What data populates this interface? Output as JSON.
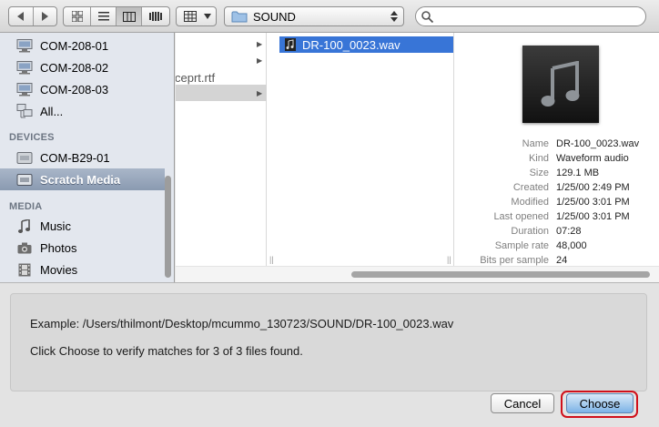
{
  "toolbar": {
    "path_popup": "SOUND",
    "search_placeholder": ""
  },
  "sidebar": {
    "shared_items": [
      "COM-208-01",
      "COM-208-02",
      "COM-208-03",
      "All..."
    ],
    "devices_header": "DEVICES",
    "devices": [
      {
        "label": "COM-B29-01",
        "icon": "drive-icon",
        "selected": false
      },
      {
        "label": "Scratch Media",
        "icon": "drive-icon",
        "selected": true
      }
    ],
    "media_header": "MEDIA",
    "media": [
      {
        "label": "Music",
        "icon": "music-note-icon"
      },
      {
        "label": "Photos",
        "icon": "camera-icon"
      },
      {
        "label": "Movies",
        "icon": "film-icon"
      }
    ]
  },
  "columns": {
    "col1_partial_file": "ceprt.rtf",
    "selected_file": "DR-100_0023.wav"
  },
  "preview": {
    "rows": [
      {
        "key": "Name",
        "value": "DR-100_0023.wav"
      },
      {
        "key": "Kind",
        "value": "Waveform audio"
      },
      {
        "key": "Size",
        "value": "129.1 MB"
      },
      {
        "key": "Created",
        "value": "1/25/00 2:49 PM"
      },
      {
        "key": "Modified",
        "value": "1/25/00 3:01 PM"
      },
      {
        "key": "Last opened",
        "value": "1/25/00 3:01 PM"
      },
      {
        "key": "Duration",
        "value": "07:28"
      },
      {
        "key": "Sample rate",
        "value": "48,000"
      },
      {
        "key": "Bits per sample",
        "value": "24"
      }
    ]
  },
  "message": {
    "example": "Example:  /Users/thilmont/Desktop/mcummo_130723/SOUND/DR-100_0023.wav",
    "instruction": "Click Choose to verify matches for 3 of 3 files found."
  },
  "buttons": {
    "cancel": "Cancel",
    "choose": "Choose"
  },
  "colors": {
    "selection": "#3875d7",
    "sidebar_bg": "#e3e7ee",
    "highlight_ring": "#d0101a"
  }
}
